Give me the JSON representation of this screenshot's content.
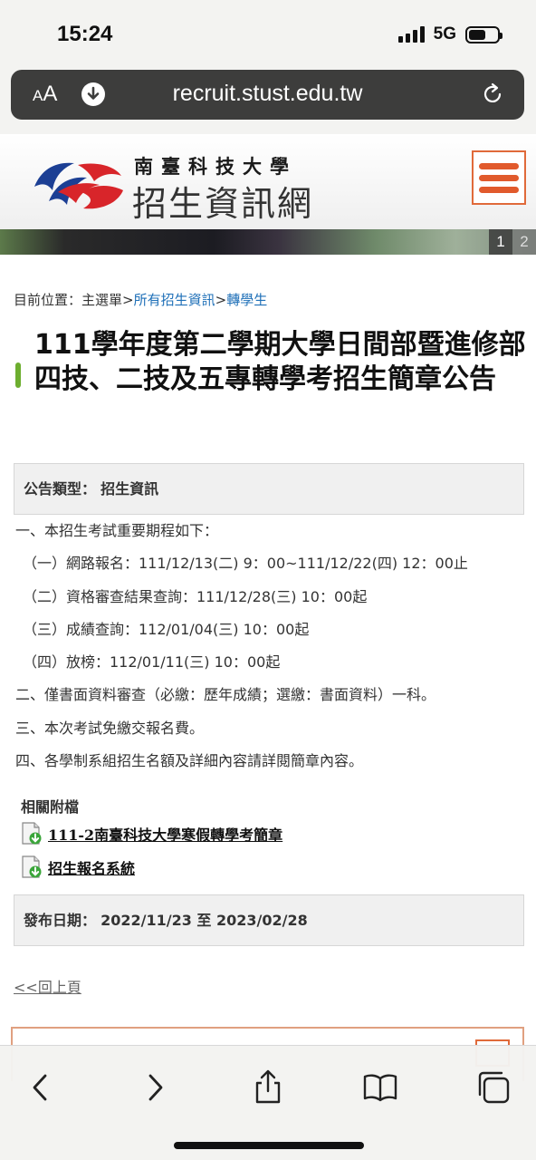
{
  "status_bar": {
    "time": "15:24",
    "network": "5G"
  },
  "browser": {
    "text_size_label_small": "A",
    "text_size_label_big": "A",
    "url": "recruit.stust.edu.tw"
  },
  "site": {
    "name_small": "南臺科技大學",
    "name_big": "招生資訊網"
  },
  "banner": {
    "pages": [
      "1",
      "2"
    ],
    "active_page": "1"
  },
  "breadcrumb": {
    "prefix": "目前位置：",
    "home": "主選單",
    "sep1": ">",
    "category": "所有招生資訊",
    "sep2": ">",
    "current": "轉學生"
  },
  "article": {
    "title": "111學年度第二學期大學日間部暨進修部四技、二技及五專轉學考招生簡章公告",
    "type_label": "公告類型：",
    "type_value": "招生資訊",
    "schedule": [
      "一、本招生考試重要期程如下：",
      "（一）網路報名：111/12/13(二) 9：00~111/12/22(四) 12：00止",
      "（二）資格審查結果查詢：111/12/28(三) 10：00起",
      "（三）成績查詢：112/01/04(三) 10：00起",
      "（四）放榜：112/01/11(三) 10：00起",
      "二、僅書面資料審查（必繳：歷年成績；選繳：書面資料）一科。",
      "三、本次考試免繳交報名費。",
      "四、各學制系組招生名額及詳細內容請詳閱簡章內容。"
    ],
    "attachments_heading": "相關附檔",
    "attachments": [
      "111-2南臺科技大學寒假轉學考簡章",
      "招生報名系統"
    ],
    "date_label": "發布日期：",
    "date_value": "2022/11/23 至 2023/02/28",
    "back_link": "<<回上頁"
  },
  "colors": {
    "accent_orange": "#e15a2c",
    "title_marker_green": "#6dae2f",
    "link_blue": "#1f70b8",
    "url_bar_bg": "#3d3d3c"
  },
  "icons": {
    "toolbar": [
      "back-icon",
      "forward-icon",
      "share-icon",
      "bookmarks-icon",
      "tabs-icon"
    ],
    "attachment": "file-download-icon",
    "reload": "reload-icon",
    "download": "download-icon",
    "menu": "hamburger-menu-icon"
  }
}
